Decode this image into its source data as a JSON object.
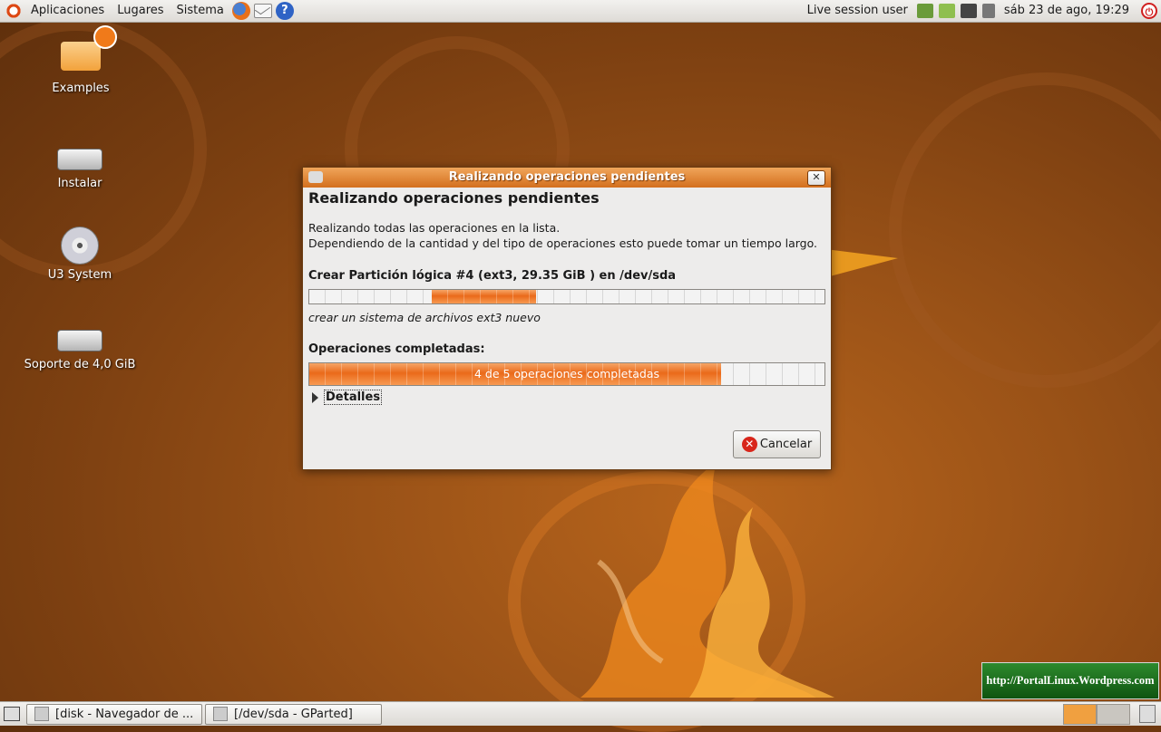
{
  "top_panel": {
    "menus": [
      "Aplicaciones",
      "Lugares",
      "Sistema"
    ],
    "launchers": [
      "firefox-icon",
      "mail-icon",
      "help-icon"
    ],
    "session_label": "Live session user",
    "clock": "sáb 23 de ago, 19:29"
  },
  "desktop_icons": [
    {
      "label": "Examples",
      "icon": "folder-icon"
    },
    {
      "label": "Instalar",
      "icon": "install-icon"
    },
    {
      "label": "U3 System",
      "icon": "cd-icon"
    },
    {
      "label": "Soporte de 4,0 GiB",
      "icon": "usb-drive-icon"
    }
  ],
  "dialog": {
    "title": "Realizando operaciones pendientes",
    "heading": "Realizando operaciones pendientes",
    "description_line1": "Realizando todas las operaciones en la lista.",
    "description_line2": "Dependiendo de la cantidad y del tipo de operaciones esto puede tomar un tiempo largo.",
    "operation_title": "Crear Partición lógica #4 (ext3, 29.35 GiB ) en /dev/sda",
    "operation_substatus": "crear un sistema de archivos ext3 nuevo",
    "completed_label": "Operaciones completadas:",
    "completed_progress_text": "4 de 5 operaciones completadas",
    "completed_fraction": 0.8,
    "details_label": "Detalles",
    "cancel_label": "Cancelar"
  },
  "watermark": "http://PortalLinux.Wordpress.com",
  "taskbar": {
    "tasks": [
      "[disk - Navegador de ...",
      "[/dev/sda - GParted]"
    ]
  },
  "colors": {
    "accent": "#ea6a1a",
    "titlebar": "#d36f1e",
    "desktop": "#9a5217"
  }
}
